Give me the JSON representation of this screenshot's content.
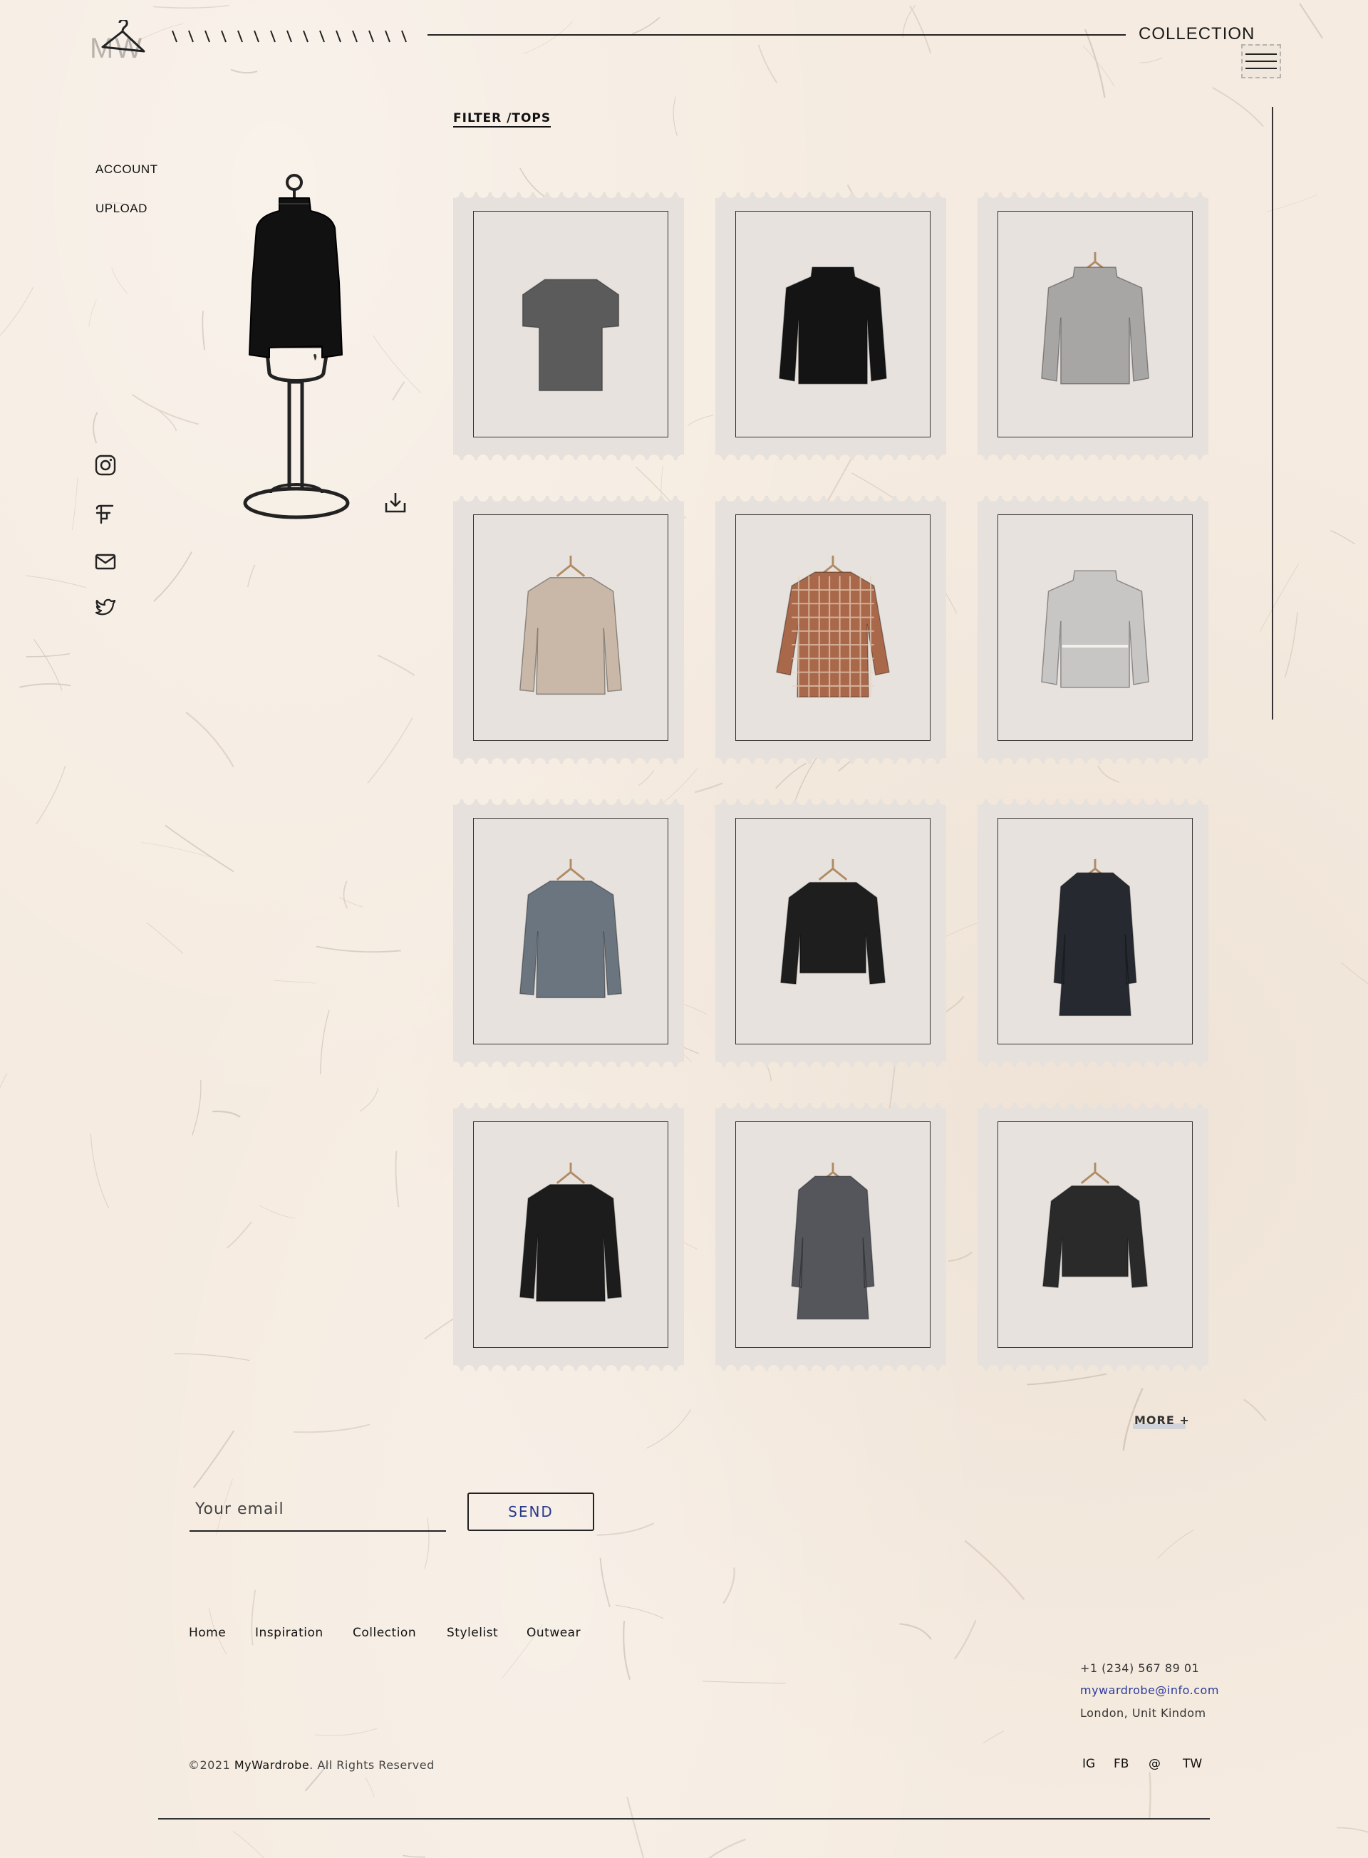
{
  "header": {
    "logo_text": "MW",
    "section_title": "COLLECTION"
  },
  "left_nav": {
    "items": [
      {
        "label": "ACCOUNT"
      },
      {
        "label": "UPLOAD"
      }
    ],
    "social_icons": [
      "instagram-icon",
      "facebook-icon",
      "mail-icon",
      "twitter-icon"
    ]
  },
  "filter": {
    "label": "FILTER /TOPS"
  },
  "collection": {
    "items": [
      {
        "name": "grey-short-sleeve-knit",
        "color": "#5b5b5b"
      },
      {
        "name": "black-turtleneck-sweater",
        "color": "#141414"
      },
      {
        "name": "grey-v-neck-sweater",
        "color": "#a8a6a4"
      },
      {
        "name": "beige-blazer",
        "color": "#c9b8a8"
      },
      {
        "name": "plaid-flannel-shirt",
        "color": "#a9684a"
      },
      {
        "name": "light-grey-belted-sweater",
        "color": "#c8c6c4"
      },
      {
        "name": "grey-wool-blazer",
        "color": "#6a7580"
      },
      {
        "name": "black-shearling-jacket",
        "color": "#1e1e1e"
      },
      {
        "name": "dark-navy-long-coat",
        "color": "#262a30"
      },
      {
        "name": "black-leather-blazer",
        "color": "#1c1c1c"
      },
      {
        "name": "check-long-coat",
        "color": "#55565c"
      },
      {
        "name": "black-tweed-jacket",
        "color": "#2a2a2a"
      }
    ],
    "more_label": "MORE +"
  },
  "newsletter": {
    "placeholder": "Your email",
    "button_label": "SEND"
  },
  "footer": {
    "links": [
      "Home",
      "Inspiration",
      "Collection",
      "Stylelist",
      "Outwear"
    ],
    "phone": "+1 (234) 567 89 01",
    "email": "mywardrobe@info.com",
    "address": "London, Unit Kindom",
    "copyright_prefix": "©2021 ",
    "brand": "MyWardrobe",
    "copyright_suffix": ". All Rights Reserved",
    "social": [
      "IG",
      "FB",
      "@",
      "TW"
    ]
  },
  "colors": {
    "background": "#f5ebe0",
    "stamp": "#e6e1dc",
    "accent": "#2a3a8c"
  }
}
